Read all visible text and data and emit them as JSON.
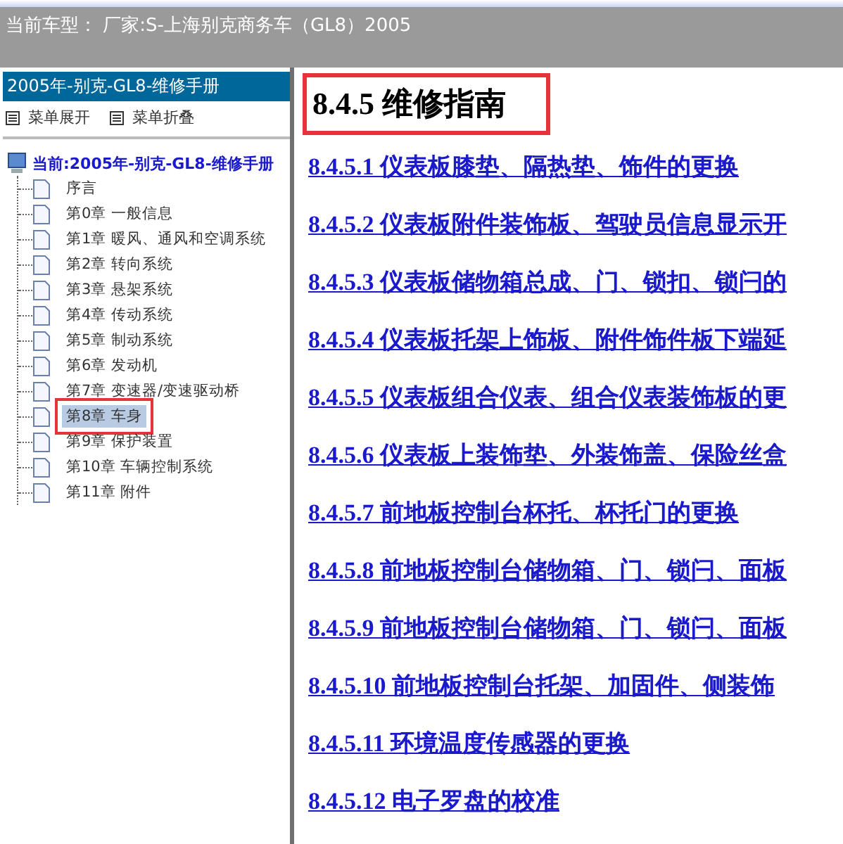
{
  "header": {
    "text": "当前车型：  厂家:S-上海别克商务车（GL8）2005"
  },
  "sidebar": {
    "title": "2005年-别克-GL8-维修手册",
    "menu": [
      {
        "label": "菜单展开"
      },
      {
        "label": "菜单折叠"
      }
    ],
    "tree": {
      "label": "当前:2005年-别克-GL8-维修手册",
      "children": [
        {
          "label": "序言",
          "selected": false
        },
        {
          "label": "第0章 一般信息",
          "selected": false
        },
        {
          "label": "第1章 暖风、通风和空调系统",
          "selected": false
        },
        {
          "label": "第2章 转向系统",
          "selected": false
        },
        {
          "label": "第3章 悬架系统",
          "selected": false
        },
        {
          "label": "第4章 传动系统",
          "selected": false
        },
        {
          "label": "第5章 制动系统",
          "selected": false
        },
        {
          "label": "第6章 发动机",
          "selected": false
        },
        {
          "label": "第7章 变速器/变速驱动桥",
          "selected": false
        },
        {
          "label": "第8章 车身",
          "selected": true
        },
        {
          "label": "第9章 保护装置",
          "selected": false
        },
        {
          "label": "第10章 车辆控制系统",
          "selected": false
        },
        {
          "label": "第11章 附件",
          "selected": false
        }
      ]
    }
  },
  "content": {
    "heading": {
      "text": "8.4.5 维修指南",
      "highlighted": true
    },
    "links": [
      "8.4.5.1 仪表板膝垫、隔热垫、饰件的更换",
      "8.4.5.2 仪表板附件装饰板、驾驶员信息显示开",
      "8.4.5.3 仪表板储物箱总成、门、锁扣、锁闩的",
      "8.4.5.4 仪表板托架上饰板、附件饰件板下端延",
      "8.4.5.5 仪表板组合仪表、组合仪表装饰板的更",
      "8.4.5.6 仪表板上装饰垫、外装饰盖、保险丝盒",
      "8.4.5.7 前地板控制台杯托、杯托门的更换",
      "8.4.5.8 前地板控制台储物箱、门、锁闩、面板",
      "8.4.5.9 前地板控制台储物箱、门、锁闩、面板",
      "8.4.5.10 前地板控制台托架、加固件、侧装饰",
      "8.4.5.11 环境温度传感器的更换",
      "8.4.5.12 电子罗盘的校准"
    ]
  }
}
